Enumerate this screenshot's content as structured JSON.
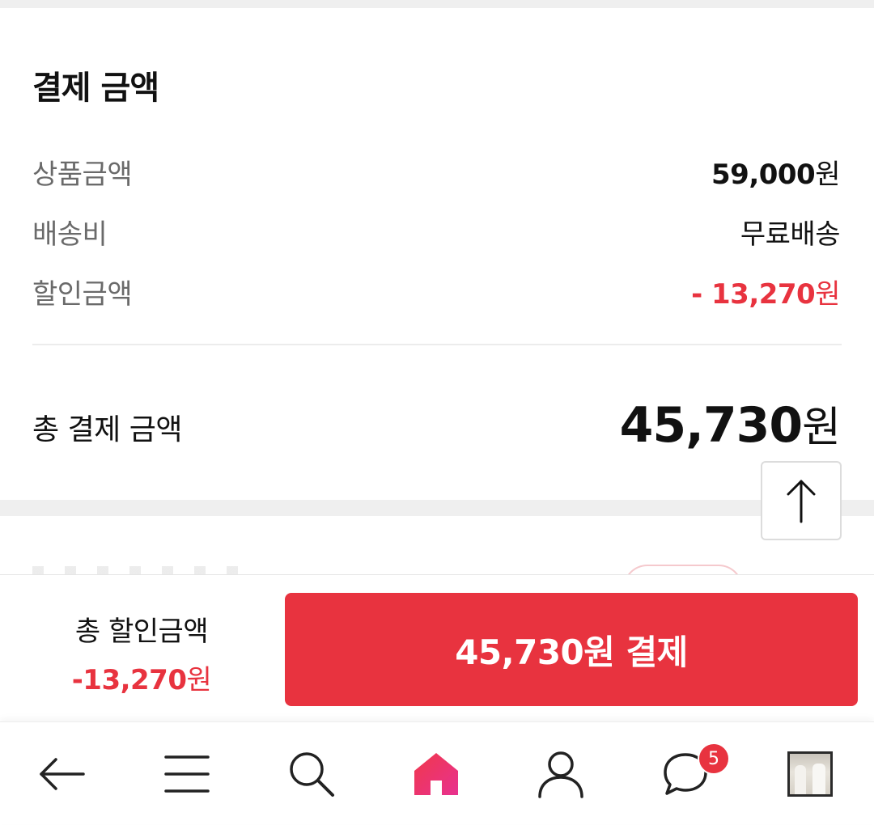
{
  "summary": {
    "title": "결제 금액",
    "rows": [
      {
        "label": "상품금액",
        "value": "59,000",
        "unit": "원"
      },
      {
        "label": "배송비",
        "value": "무료배송"
      },
      {
        "label": "할인금액",
        "value": "- 13,270",
        "unit": "원"
      }
    ],
    "total_label": "총 결제 금액",
    "total_value": "45,730",
    "total_unit": "원"
  },
  "paybar": {
    "discount_label": "총 할인금액",
    "discount_value": "-13,270",
    "discount_unit": "원",
    "pay_button_label": "45,730원 결제"
  },
  "nav": {
    "items": [
      {
        "icon": "back-arrow-icon"
      },
      {
        "icon": "menu-icon"
      },
      {
        "icon": "search-icon"
      },
      {
        "icon": "home-icon"
      },
      {
        "icon": "user-icon"
      },
      {
        "icon": "chat-icon"
      },
      {
        "icon": "recent-product-thumbnail"
      }
    ],
    "chat_badge": "5"
  },
  "colors": {
    "accent": "#e8333f",
    "text": "#111111",
    "muted": "#6a6a6a"
  }
}
